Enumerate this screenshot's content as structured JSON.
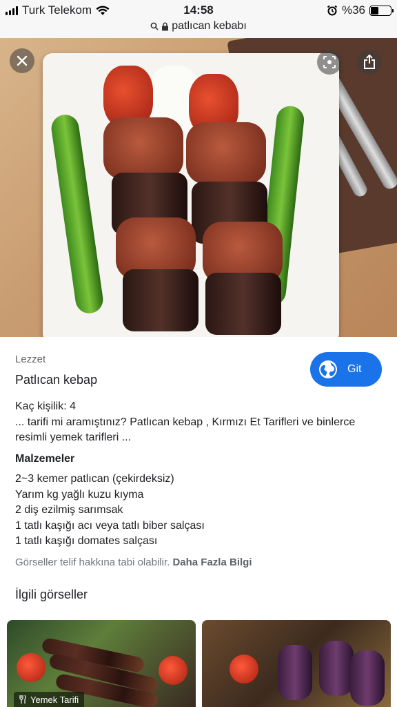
{
  "status_bar": {
    "carrier": "Turk Telekom",
    "time": "14:58",
    "battery": "%36",
    "battery_level": 0.36
  },
  "url_bar": {
    "domain": "patlıcan kebabı"
  },
  "hero": {
    "close_icon": "close-icon",
    "lens_icon": "lens-icon",
    "share_icon": "share-icon"
  },
  "result": {
    "source": "Lezzet",
    "title": "Patlıcan kebap",
    "visit_label": "Git",
    "servings": "Kaç kişilik: 4",
    "description": "... tarifi mi aramıştınız? Patlıcan kebap , Kırmızı Et Tarifleri ve binlerce resimli yemek tarifleri ...",
    "ingredients_heading": "Malzemeler",
    "ingredients": [
      "2~3 kemer patlıcan (çekirdeksiz)",
      "Yarım kg yağlı kuzu kıyma",
      "2 diş ezilmiş sarımsak",
      "1 tatlı kaşığı acı veya tatlı biber salçası",
      "1 tatlı kaşığı domates salçası"
    ],
    "copyright_text": "Görseller telif hakkına tabi olabilir.",
    "more_info": "Daha Fazla Bilgi"
  },
  "related": {
    "heading": "İlgili görseller",
    "items": [
      {
        "badge": "Yemek Tarifi"
      },
      {
        "badge": ""
      }
    ]
  },
  "colors": {
    "accent": "#1a73e8",
    "text": "#202124",
    "muted": "#5f6368"
  }
}
